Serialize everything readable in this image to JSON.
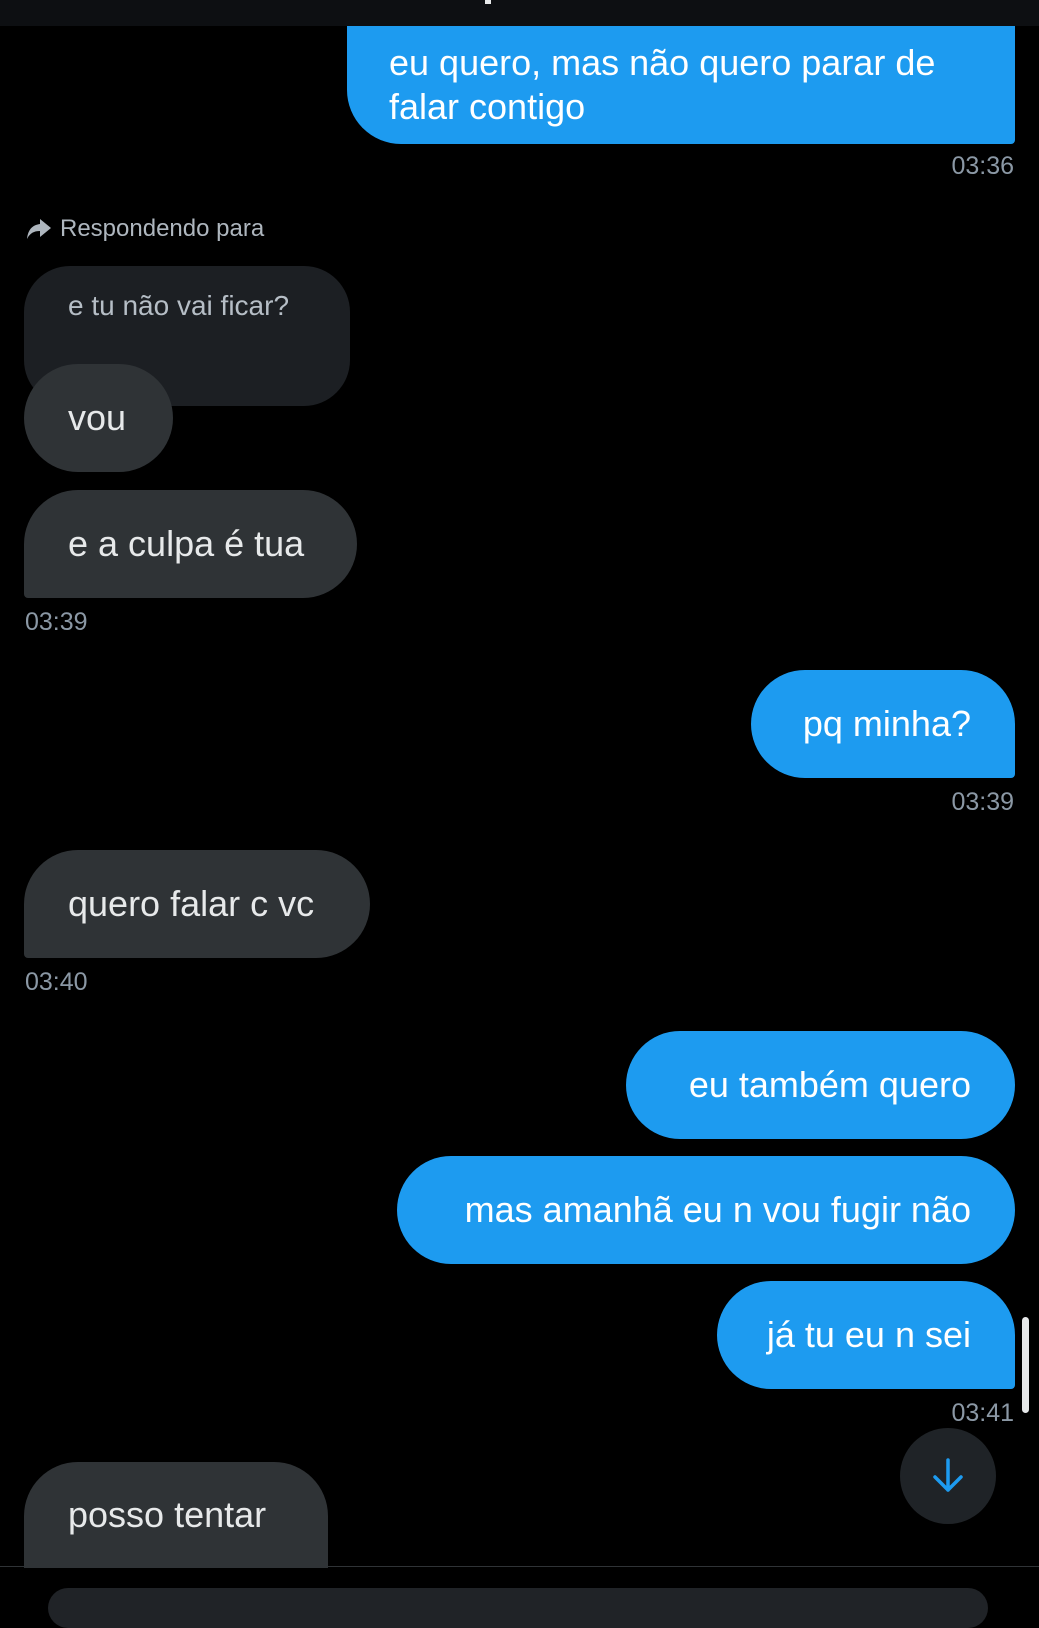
{
  "colors": {
    "background": "#000000",
    "sent_bubble": "#1d9bf0",
    "received_bubble": "#2f3336",
    "timestamp": "#8b98a5",
    "accent": "#1d9bf0"
  },
  "reply_context": {
    "label": "Respondendo para",
    "icon": "reply-arrow-icon",
    "quoted_text": "e tu não vai ficar?"
  },
  "messages": [
    {
      "id": "m1",
      "direction": "sent",
      "lines": [
        "eu quero, mas não quero parar de",
        "falar contigo"
      ]
    },
    {
      "id": "m2",
      "direction": "received",
      "text": "vou"
    },
    {
      "id": "m3",
      "direction": "received",
      "text": "e a culpa é tua"
    },
    {
      "id": "m4",
      "direction": "sent",
      "text": "pq minha?"
    },
    {
      "id": "m5",
      "direction": "received",
      "text": "quero falar c vc"
    },
    {
      "id": "m6",
      "direction": "sent",
      "text": "eu também quero"
    },
    {
      "id": "m7",
      "direction": "sent",
      "text": "mas amanhã eu n vou fugir não"
    },
    {
      "id": "m8",
      "direction": "sent",
      "text": "já tu eu n sei"
    },
    {
      "id": "m9",
      "direction": "received",
      "text": "posso tentar"
    }
  ],
  "timestamps": [
    "03:36",
    "03:39",
    "03:39",
    "03:40",
    "03:41"
  ],
  "scroll_to_bottom": {
    "icon": "arrow-down-icon"
  }
}
